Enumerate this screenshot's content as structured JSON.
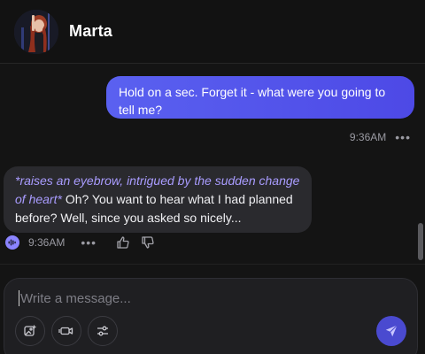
{
  "header": {
    "name": "Marta"
  },
  "messages": [
    {
      "role": "user",
      "text": "Hold on a sec. Forget it - what were you going to tell me?",
      "time": "9:36AM"
    },
    {
      "role": "assistant",
      "action": "*raises an eyebrow, intrigued by the sudden change of heart*",
      "text": " Oh? You want to hear what I had planned before? Well, since you asked so nicely...",
      "time": "9:36AM"
    }
  ],
  "more_glyph": "•••",
  "composer": {
    "placeholder": "Write a message..."
  },
  "icons": {
    "audio": "audio-wave-icon",
    "more": "more-dots-icon",
    "like": "thumbs-up-icon",
    "dislike": "thumbs-down-icon",
    "image": "image-add-icon",
    "video": "video-camera-icon",
    "settings": "sliders-icon",
    "send": "send-icon"
  },
  "colors": {
    "accent": "#5a61f0",
    "user_bubble": "#4d49e6",
    "ai_bubble": "#2a2a2e",
    "action_text": "#a99cff",
    "background": "#141414"
  }
}
